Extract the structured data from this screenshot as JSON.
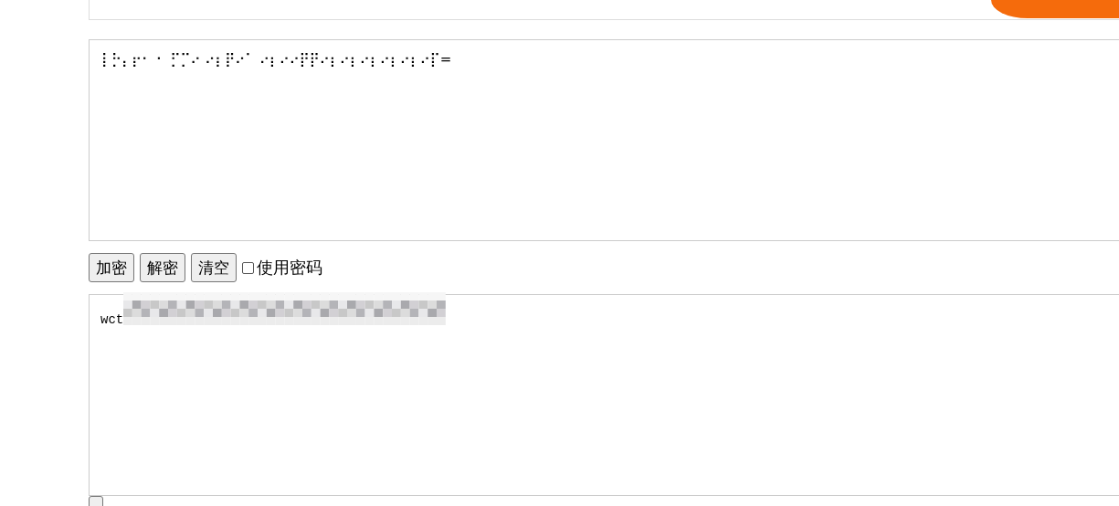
{
  "input_box": {
    "value": "⡇⡓⡄⡖⠂ ⠂ ⡋⡉⠔ ⠔⡆⡟⠔⠁ ⠔⡆⠔⠔⡟⡟⠔⡆⠔⡆⠔⡆⠔⡆⠔⡆⠔⡏="
  },
  "buttons": [
    "加密",
    "解密",
    "清空"
  ],
  "use_password": {
    "label": "使用密码",
    "checked": false
  },
  "output_box": {
    "value": "wct",
    "redacted": true
  }
}
